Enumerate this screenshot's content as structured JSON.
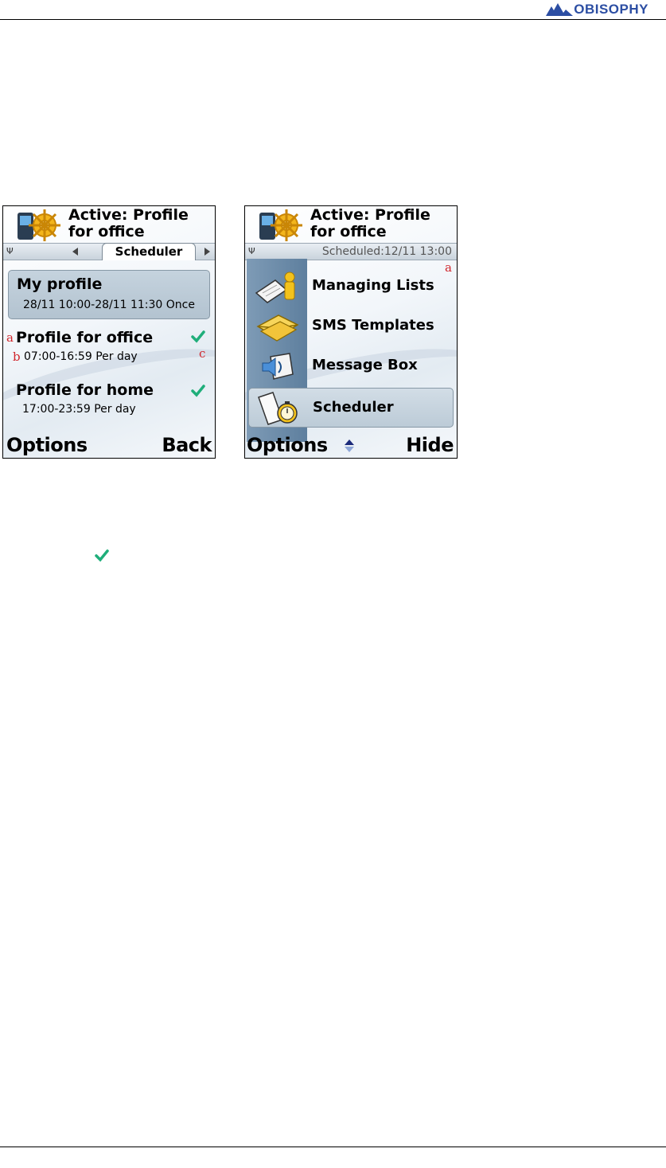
{
  "brand": {
    "logo_text": "OBISOPHY",
    "color": "#2c4ea3"
  },
  "screen1": {
    "title": "Active: Profile\nfor office",
    "tab_label": "Scheduler",
    "items": [
      {
        "title": "My profile",
        "subtitle": "28/11 10:00-28/11 11:30 Once",
        "checked": false
      },
      {
        "title": "Profile for office",
        "subtitle": "07:00-16:59 Per day",
        "checked": true
      },
      {
        "title": "Profile for home",
        "subtitle": "17:00-23:59 Per day",
        "checked": true
      }
    ],
    "annotations": {
      "a": "a",
      "b": "b",
      "c": "c"
    },
    "softkeys": {
      "left": "Options",
      "right": "Back"
    }
  },
  "screen2": {
    "title": "Active: Profile\nfor office",
    "status": "Scheduled:12/11 13:00",
    "annotation_a": "a",
    "menu": [
      {
        "label": "Managing Lists",
        "icon": "contacts-book-icon"
      },
      {
        "label": "SMS Templates",
        "icon": "envelope-icon"
      },
      {
        "label": "Message Box",
        "icon": "speaker-box-icon"
      },
      {
        "label": "Scheduler",
        "icon": "stopwatch-icon"
      }
    ],
    "softkeys": {
      "left": "Options",
      "right": "Hide"
    }
  },
  "colors": {
    "check": "#1fae7a",
    "annotation": "#d0262c",
    "selection": "#bccbd7"
  }
}
